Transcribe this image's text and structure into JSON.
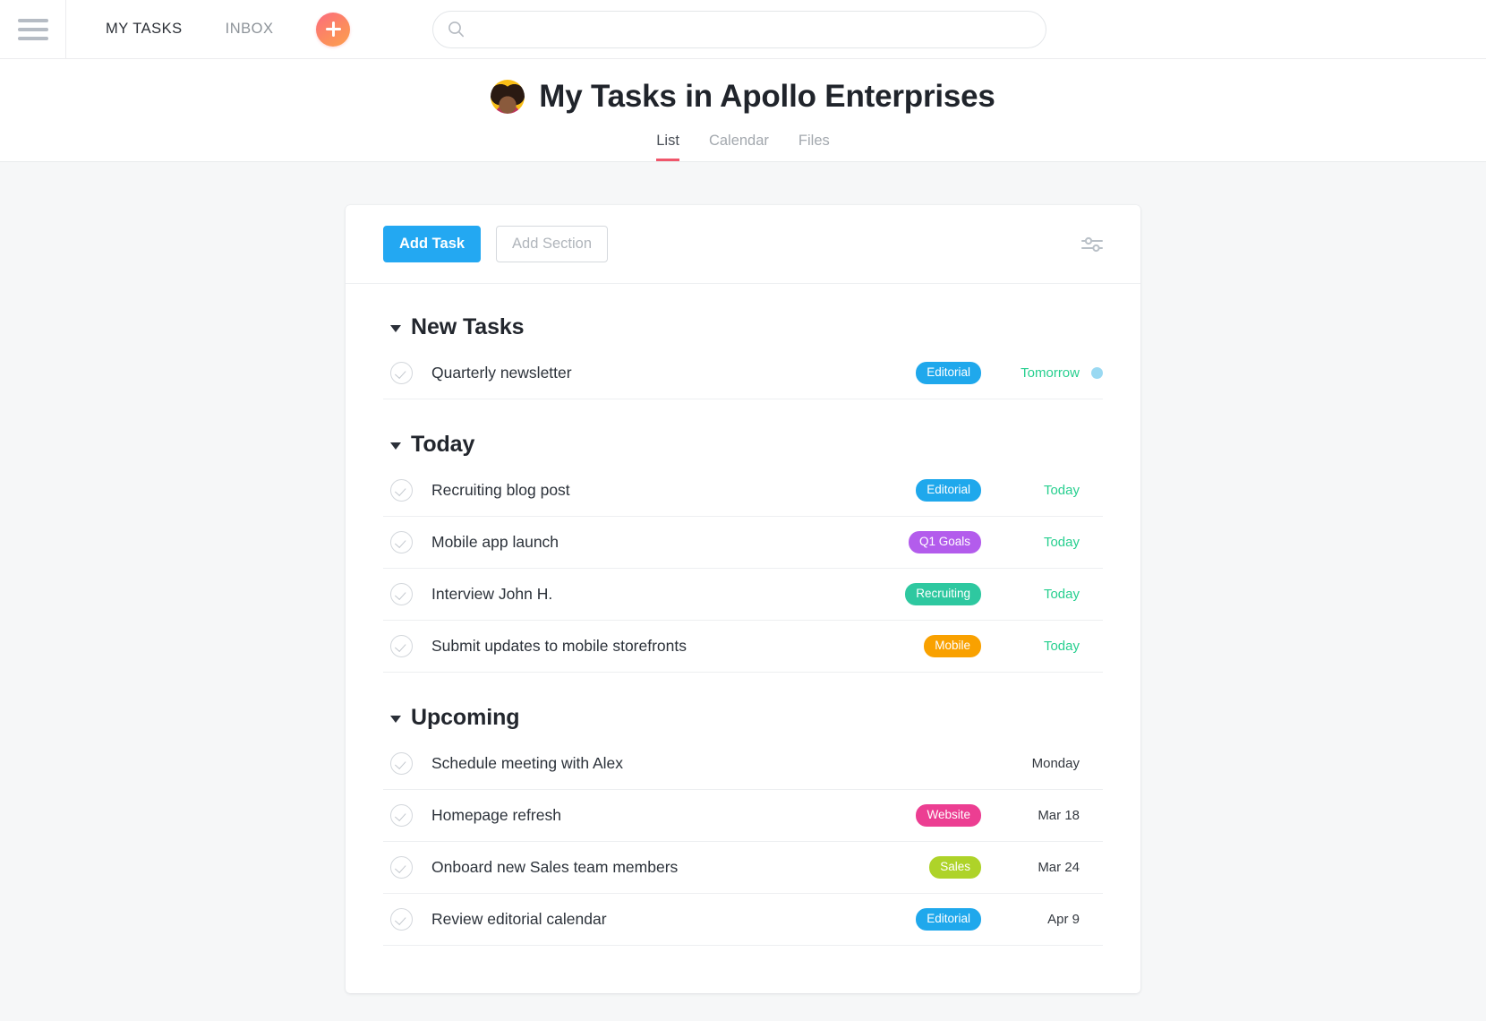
{
  "topbar": {
    "menu_icon": "hamburger-icon",
    "nav": [
      {
        "label": "MY TASKS",
        "active": true
      },
      {
        "label": "INBOX",
        "active": false
      }
    ],
    "add_button_icon": "plus-icon",
    "search": {
      "icon": "search-icon",
      "value": "",
      "placeholder": ""
    }
  },
  "page_header": {
    "avatar": "user-avatar",
    "title": "My Tasks in Apollo Enterprises",
    "tabs": [
      {
        "label": "List",
        "active": true
      },
      {
        "label": "Calendar",
        "active": false
      },
      {
        "label": "Files",
        "active": false
      }
    ]
  },
  "toolbar": {
    "add_task_label": "Add Task",
    "add_section_label": "Add Section",
    "filter_icon": "sliders-icon"
  },
  "colors": {
    "accent_blue": "#23a8f2",
    "tab_underline": "#f0566b",
    "tag_editorial": "#1fa8ec",
    "tag_q1goals": "#b35cec",
    "tag_recruiting": "#2ec8a0",
    "tag_mobile": "#f9a100",
    "tag_website": "#ec3e92",
    "tag_sales": "#aed329",
    "due_soon": "#27cf8f",
    "due_normal": "#33383f",
    "dot_blue": "#9ad9f2"
  },
  "sections": [
    {
      "title": "New Tasks",
      "collapsed": false,
      "tasks": [
        {
          "name": "Quarterly newsletter",
          "tag": "Editorial",
          "tag_color": "#1fa8ec",
          "due": "Tomorrow",
          "due_style": "soon",
          "has_dot": true
        }
      ]
    },
    {
      "title": "Today",
      "collapsed": false,
      "tasks": [
        {
          "name": "Recruiting blog post",
          "tag": "Editorial",
          "tag_color": "#1fa8ec",
          "due": "Today",
          "due_style": "soon",
          "has_dot": false
        },
        {
          "name": "Mobile app launch",
          "tag": "Q1 Goals",
          "tag_color": "#b35cec",
          "due": "Today",
          "due_style": "soon",
          "has_dot": false
        },
        {
          "name": "Interview John H.",
          "tag": "Recruiting",
          "tag_color": "#2ec8a0",
          "due": "Today",
          "due_style": "soon",
          "has_dot": false
        },
        {
          "name": "Submit updates to mobile storefronts",
          "tag": "Mobile",
          "tag_color": "#f9a100",
          "due": "Today",
          "due_style": "soon",
          "has_dot": false
        }
      ]
    },
    {
      "title": "Upcoming",
      "collapsed": false,
      "tasks": [
        {
          "name": "Schedule meeting with Alex",
          "tag": "",
          "tag_color": "",
          "due": "Monday",
          "due_style": "normal",
          "has_dot": false
        },
        {
          "name": "Homepage refresh",
          "tag": "Website",
          "tag_color": "#ec3e92",
          "due": "Mar 18",
          "due_style": "normal",
          "has_dot": false
        },
        {
          "name": "Onboard new Sales team members",
          "tag": "Sales",
          "tag_color": "#aed329",
          "due": "Mar 24",
          "due_style": "normal",
          "has_dot": false
        },
        {
          "name": "Review editorial calendar",
          "tag": "Editorial",
          "tag_color": "#1fa8ec",
          "due": "Apr 9",
          "due_style": "normal",
          "has_dot": false
        }
      ]
    }
  ]
}
